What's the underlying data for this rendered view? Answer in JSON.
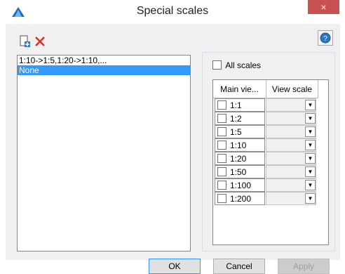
{
  "window": {
    "title": "Special scales",
    "close_glyph": "×"
  },
  "toolbar": {
    "new_icon": "new-document-icon",
    "delete_icon": "delete-x-icon",
    "help_icon": "help-icon"
  },
  "list": {
    "items": [
      {
        "label": "1:10->1:5,1:20->1:10,...",
        "selected": false
      },
      {
        "label": "None",
        "selected": true
      }
    ]
  },
  "options": {
    "all_scales_label": "All scales",
    "all_scales_checked": false,
    "columns": [
      "Main vie...",
      "View scale"
    ],
    "rows": [
      {
        "scale": "1:1",
        "checked": false,
        "view_scale": ""
      },
      {
        "scale": "1:2",
        "checked": false,
        "view_scale": ""
      },
      {
        "scale": "1:5",
        "checked": false,
        "view_scale": ""
      },
      {
        "scale": "1:10",
        "checked": false,
        "view_scale": ""
      },
      {
        "scale": "1:20",
        "checked": false,
        "view_scale": ""
      },
      {
        "scale": "1:50",
        "checked": false,
        "view_scale": ""
      },
      {
        "scale": "1:100",
        "checked": false,
        "view_scale": ""
      },
      {
        "scale": "1:200",
        "checked": false,
        "view_scale": ""
      }
    ]
  },
  "buttons": {
    "ok": "OK",
    "cancel": "Cancel",
    "apply": "Apply"
  },
  "colors": {
    "selection": "#3399ff",
    "close": "#c75050",
    "delete": "#e0301e"
  }
}
